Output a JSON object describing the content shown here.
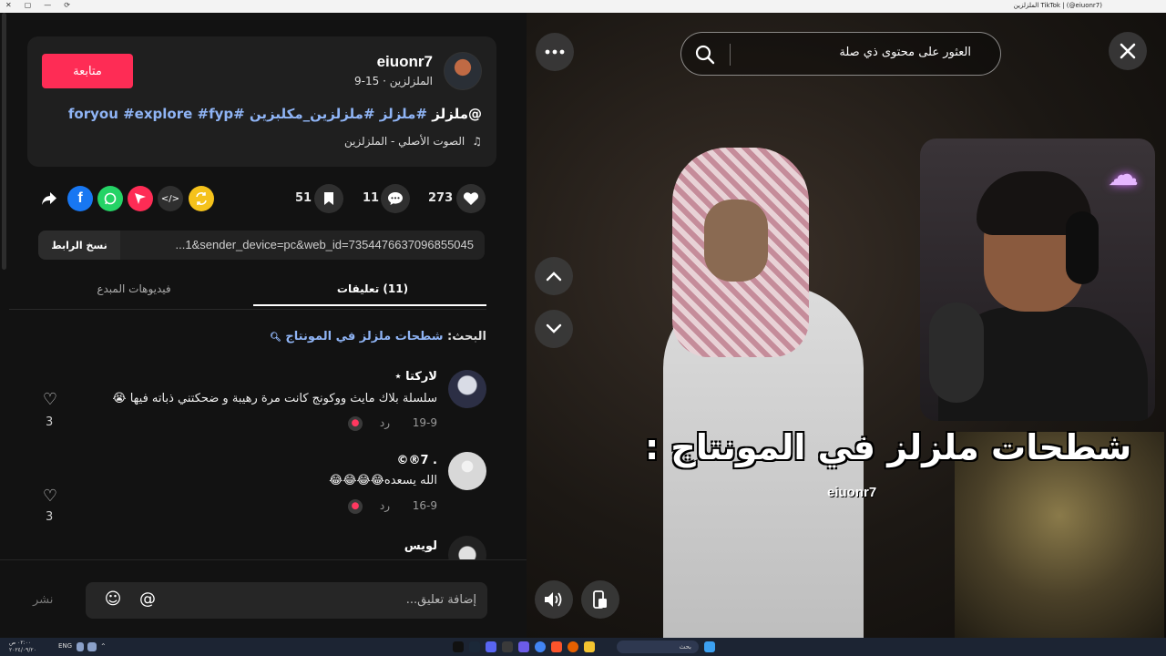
{
  "browser": {
    "title": "TikTok | (@eiuonr7) الملزلزين",
    "window_buttons": [
      "✕",
      "▢",
      "—",
      "⟳"
    ]
  },
  "post": {
    "follow_label": "متابعة",
    "username": "eiuonr7",
    "subline": "الملزلزين · 15-9",
    "caption_mention": "@ملزلز",
    "caption_tags": "#ملزلز #ملزلزين_مكلبزين #foryou #explore #fyp",
    "sound": "الصوت الأصلي - الملزلزين",
    "stats": {
      "likes": "273",
      "comments": "11",
      "saves": "51"
    },
    "share_icons": [
      "repost-icon",
      "embed-icon",
      "send-icon",
      "whatsapp-icon",
      "facebook-icon",
      "share-arrow-icon"
    ],
    "link": {
      "copy_label": "نسخ الرابط",
      "url": "...1&sender_device=pc&web_id=7354476637096855045"
    }
  },
  "tabs": [
    {
      "label": "(11) تعليقات",
      "active": true
    },
    {
      "label": "فيديوهات المبدع",
      "active": false
    }
  ],
  "search_hint": {
    "prefix": "البحث:",
    "query": "شطحات ملزلز في المونتاج"
  },
  "comments": [
    {
      "name": "ﻟﺎﺭﻛﺘﺎ ٭",
      "text": "سلسلة بلاك مايث ووكونج كانت مرة رهيبة و ضحكتني ذباته فيها 😭",
      "date": "19-9",
      "reply": "رد",
      "likes": "3"
    },
    {
      "name": ". 7®©",
      "text": "الله يسعده😂😂😂😂",
      "date": "16-9",
      "reply": "رد",
      "likes": "3"
    },
    {
      "name": "لويس",
      "text": "",
      "date": "",
      "reply": "",
      "likes": ""
    }
  ],
  "composer": {
    "placeholder": "إضافة تعليق...",
    "post_label": "نشر"
  },
  "video": {
    "search_placeholder": "العثور على محتوى ذي صلة",
    "caption": "شطحات ملزلز في المونتاج :",
    "watermark": "eiuonr7"
  },
  "taskbar": {
    "search_label": "بحث",
    "lang": "ENG",
    "time": "٠٢:٠٠ ص",
    "date": "٢٠٢٤/٠٩/٢٠"
  },
  "colors": {
    "accent": "#fe2c55",
    "link": "#8fb4f5",
    "bg": "#121212"
  }
}
